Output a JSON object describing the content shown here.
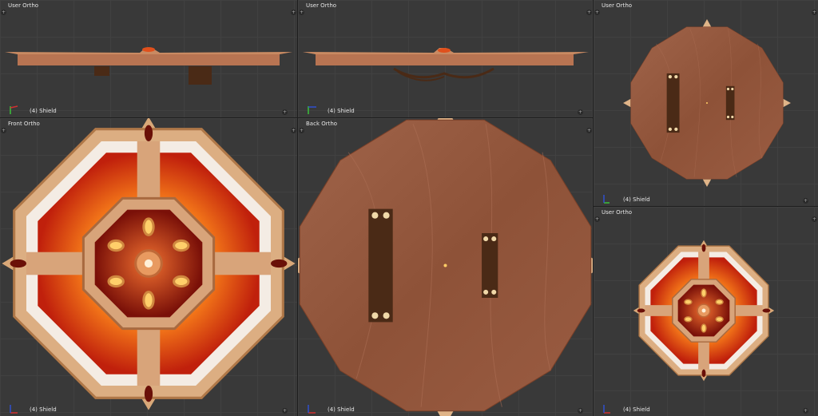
{
  "viewports": [
    {
      "id": "top-left",
      "title": "User Ortho",
      "object": "(4) Shield"
    },
    {
      "id": "top-middle",
      "title": "User Ortho",
      "object": "(4) Shield"
    },
    {
      "id": "right-top",
      "title": "User Ortho",
      "object": "(4) Shield"
    },
    {
      "id": "front",
      "title": "Front Ortho",
      "object": "(4) Shield"
    },
    {
      "id": "back",
      "title": "Back Ortho",
      "object": "(4) Shield"
    },
    {
      "id": "right-bottom",
      "title": "User Ortho",
      "object": "(4) Shield"
    }
  ],
  "colors": {
    "wood": "#9a5a3e",
    "trim": "#e0b488",
    "fire": "#e8401a",
    "handle": "#4a2a16",
    "viewport_bg": "#393939"
  }
}
